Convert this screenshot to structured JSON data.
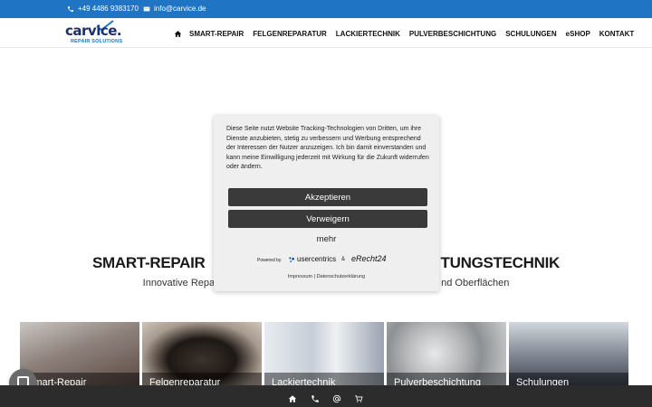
{
  "topbar": {
    "phone": "+49 4486 9383170",
    "email": "info@carvice.de"
  },
  "header": {
    "logo_word": "carvice.",
    "logo_tag": "REPAIR SOLUTIONS",
    "nav": [
      {
        "label": "SMART-REPAIR"
      },
      {
        "label": "FELGENREPARATUR"
      },
      {
        "label": "LACKIERTECHNIK"
      },
      {
        "label": "PULVERBESCHICHTUNG"
      },
      {
        "label": "SCHULUNGEN"
      },
      {
        "label": "eSHOP"
      },
      {
        "label": "KONTAKT"
      }
    ]
  },
  "hero": {
    "title_left": "SMART-REPAIR",
    "title_right": "TUNGSTECHNIK",
    "subtitle_left": "Innovative Repa",
    "subtitle_right": "nd Oberflächen"
  },
  "tiles": [
    {
      "label": "Smart-Repair",
      "color_top": "#b8b4b0",
      "color_bottom": "#6b5a52"
    },
    {
      "label": "Felgenreparatur",
      "color_top": "#9a8e84",
      "color_bottom": "#2e2722"
    },
    {
      "label": "Lackiertechnik",
      "color_top": "#dfe4ea",
      "color_bottom": "#8c95a2"
    },
    {
      "label": "Pulverbeschichtung",
      "color_top": "#d9dbdc",
      "color_bottom": "#8f9092"
    },
    {
      "label": "Schulungen",
      "color_top": "#b9c0c9",
      "color_bottom": "#4a4f5c"
    }
  ],
  "consent": {
    "text": "Diese Seite nutzt Website Tracking-Technologien von Dritten, um ihre Dienste anzubieten, stetig zu verbessern und Werbung entsprechend der Interessen der Nutzer anzuzeigen. Ich bin damit einverstanden und kann meine Einwilligung jederzeit mit Wirkung für die Zukunft widerrufen oder ändern.",
    "accept": "Akzeptieren",
    "deny": "Verweigern",
    "more": "mehr",
    "powered_by": "Powered by",
    "usercentrics": "usercentrics",
    "amp": "&",
    "erecht": "eRecht24",
    "links": "Impressum | Datenschutzerklärung"
  },
  "colors": {
    "topbar": "#1f74c4",
    "button": "#3a3a3a",
    "bottombar": "#2c2c2c",
    "brand_dark": "#1b2f6b"
  }
}
